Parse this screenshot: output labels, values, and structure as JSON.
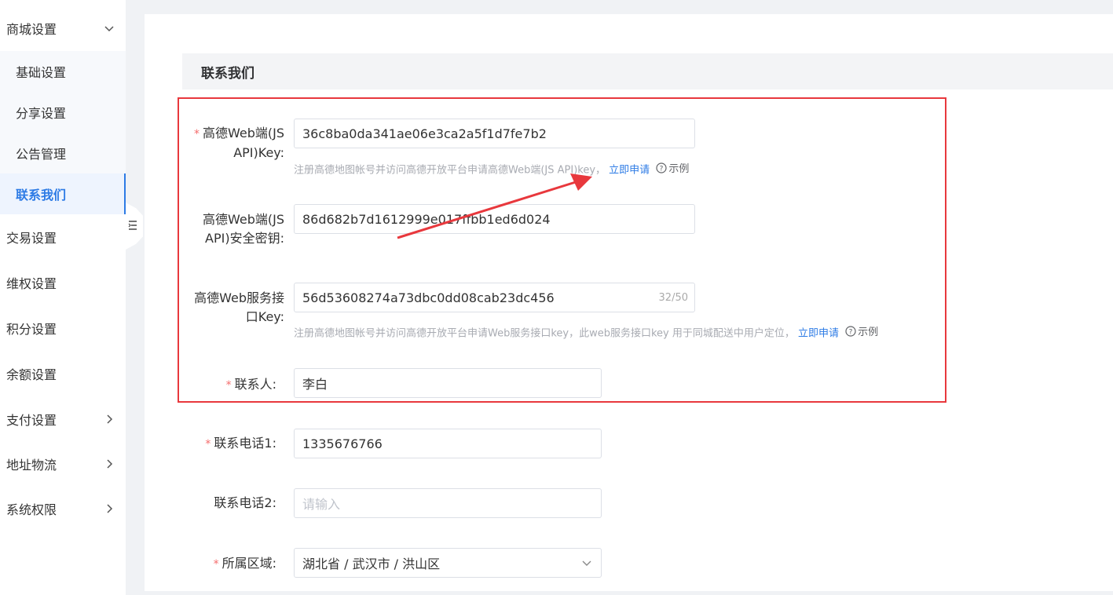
{
  "sidebar": {
    "items": [
      {
        "label": "商城设置"
      },
      {
        "label": "交易设置"
      },
      {
        "label": "维权设置"
      },
      {
        "label": "积分设置"
      },
      {
        "label": "余额设置"
      },
      {
        "label": "支付设置"
      },
      {
        "label": "地址物流"
      },
      {
        "label": "系统权限"
      }
    ],
    "sub_items": [
      {
        "label": "基础设置"
      },
      {
        "label": "分享设置"
      },
      {
        "label": "公告管理"
      },
      {
        "label": "联系我们",
        "active": true
      }
    ]
  },
  "page": {
    "section_title": "联系我们"
  },
  "form": {
    "web_js_key": {
      "label_line1": "高德Web端(JS",
      "label_line2": "API)Key:",
      "value": "36c8ba0da341ae06e3ca2a5f1d7fe7b2",
      "hint": "注册高德地图帐号并访问高德开放平台申请高德Web端(JS API)key，",
      "apply_link": "立即申请",
      "example": "示例"
    },
    "web_js_secret": {
      "label_line1": "高德Web端(JS",
      "label_line2": "API)安全密钥:",
      "value": "86d682b7d1612999e017ffbb1ed6d024"
    },
    "web_service_key": {
      "label_line1": "高德Web服务接",
      "label_line2": "口Key:",
      "value": "56d53608274a73dbc0dd08cab23dc456",
      "counter": "32/50",
      "hint": "注册高德地图帐号并访问高德开放平台申请Web服务接口key，此web服务接口key 用于同城配送中用户定位，",
      "apply_link": "立即申请",
      "example": "示例"
    },
    "contact_person": {
      "label": "联系人:",
      "value": "李白"
    },
    "phone1": {
      "label": "联系电话1:",
      "value": "1335676766"
    },
    "phone2": {
      "label": "联系电话2:",
      "placeholder": "请输入"
    },
    "region": {
      "label": "所属区域:",
      "value": "湖北省 / 武汉市 / 洪山区"
    },
    "required_mark": "*"
  },
  "colors": {
    "accent": "#2d7be5",
    "required": "#f56c6c",
    "annotation_red": "#e8383d"
  }
}
